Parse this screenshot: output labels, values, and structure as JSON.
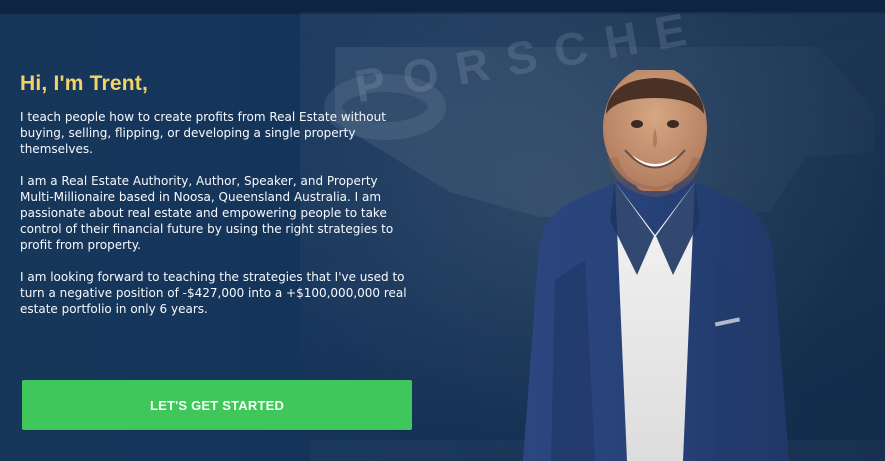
{
  "hero": {
    "greeting": "Hi, I'm Trent,",
    "paragraphs": [
      "I teach people how to create profits from Real Estate without buying, selling, flipping, or developing a single property themselves.",
      "I am a Real Estate Authority, Author, Speaker, and Property Multi-Millionaire based in Noosa, Queensland Australia. I am passionate about real estate and empowering people to take control of their financial future by using the right strategies to profit from property.",
      "I am looking forward to teaching the strategies that I've used to turn a negative position of -$427,000 into a +$100,000,000 real estate portfolio in only 6 years."
    ],
    "cta_label": "LET'S GET STARTED",
    "background_text": "PORSCHE",
    "colors": {
      "background": "#15345a",
      "accent": "#f1d36a",
      "button": "#40c75b"
    },
    "icons": {
      "background_car": "car-background",
      "person_photo": "person-photo"
    }
  }
}
